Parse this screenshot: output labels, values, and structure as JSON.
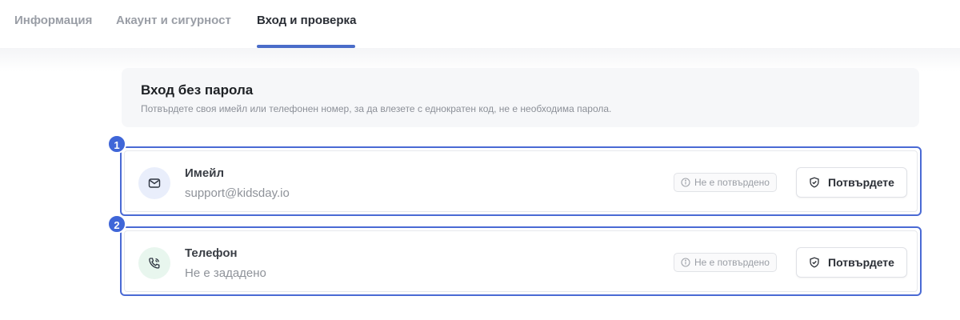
{
  "tabs": [
    {
      "label": "Информация"
    },
    {
      "label": "Акаунт и сигурност"
    },
    {
      "label": "Вход и проверка"
    }
  ],
  "section": {
    "title": "Вход без парола",
    "description": "Потвърдете своя имейл или телефонен номер, за да влезете с еднократен код, не е необходима парола."
  },
  "cards": [
    {
      "badge": "1",
      "icon": "mail-icon",
      "label": "Имейл",
      "value": "support@kidsday.io",
      "status": "Не е потвърдено",
      "button": "Потвърдете"
    },
    {
      "badge": "2",
      "icon": "phone-icon",
      "label": "Телефон",
      "value": "Не е зададено",
      "status": "Не е потвърдено",
      "button": "Потвърдете"
    }
  ],
  "colors": {
    "accent": "#4a6ad4",
    "active_tab_underline": "#4a6cc9",
    "mail_icon_bg": "#e9eefb",
    "phone_icon_bg": "#e8f6ee"
  }
}
